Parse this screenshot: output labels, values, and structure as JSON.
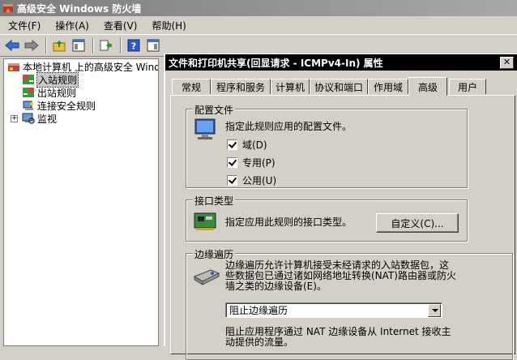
{
  "window": {
    "title": "高级安全 Windows 防火墙"
  },
  "menu": [
    {
      "label": "文件(F)"
    },
    {
      "label": "操作(A)"
    },
    {
      "label": "查看(V)"
    },
    {
      "label": "帮助(H)"
    }
  ],
  "toolbar": {
    "icons": [
      "back-arrow-icon",
      "forward-arrow-icon",
      "up-folder-icon",
      "show-hide-tree-icon",
      "export-list-icon",
      "help-icon",
      "properties-pane-icon"
    ]
  },
  "tree": {
    "root": "本地计算机 上的高级安全 Wind",
    "items": [
      {
        "label": "入站规则"
      },
      {
        "label": "出站规则"
      },
      {
        "label": "连接安全规则"
      },
      {
        "label": "监视"
      }
    ],
    "expander": "+"
  },
  "dialog": {
    "title": "文件和打印机共享(回显请求 - ICMPv4-In) 属性",
    "close": "✕",
    "tabs": [
      {
        "label": "常规"
      },
      {
        "label": "程序和服务"
      },
      {
        "label": "计算机"
      },
      {
        "label": "协议和端口"
      },
      {
        "label": "作用域"
      },
      {
        "label": "高级"
      },
      {
        "label": "用户"
      }
    ],
    "active_tab": "高级",
    "profiles": {
      "legend": "配置文件",
      "description": "指定此规则应用的配置文件。",
      "options": [
        {
          "label": "域(D)",
          "checked": true
        },
        {
          "label": "专用(P)",
          "checked": true
        },
        {
          "label": "公用(U)",
          "checked": true
        }
      ]
    },
    "interface": {
      "legend": "接口类型",
      "description": "指定应用此规则的接口类型。",
      "button": "自定义(C)..."
    },
    "edge": {
      "legend": "边缘遍历",
      "description_lines": [
        "边缘遍历允许计算机接受未经请求的入站数据包，这",
        "些数据包已通过诸如网络地址转换(NAT)路由器或防火",
        "墙之类的边缘设备(E)。"
      ],
      "select_value": "阻止边缘遍历",
      "help_lines": [
        "阻止应用程序通过 NAT 边缘设备从 Internet 接收主",
        "动提供的流量。"
      ]
    }
  }
}
